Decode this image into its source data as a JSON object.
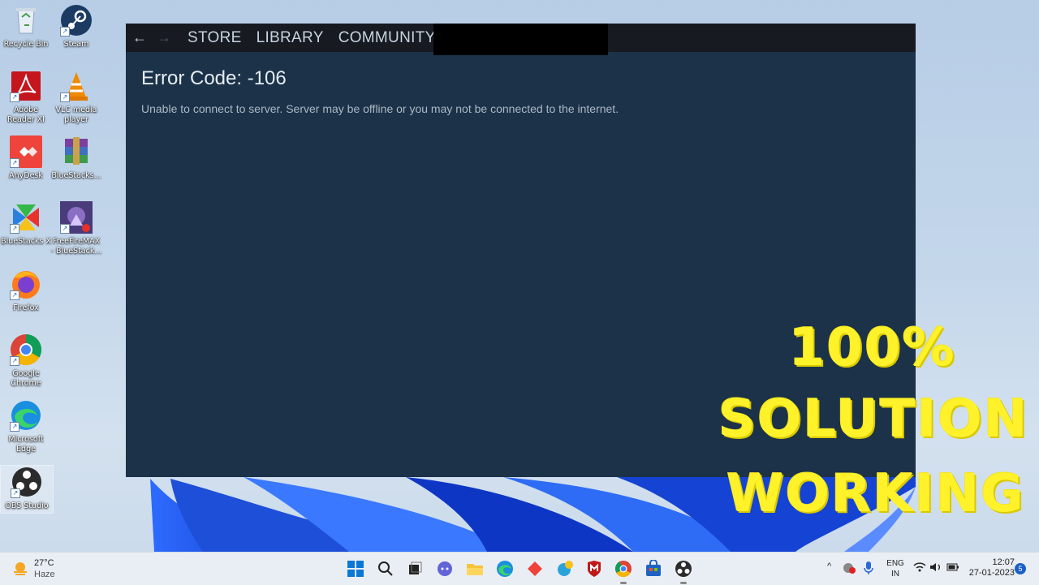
{
  "desktop": {
    "icons": [
      {
        "label": "Recycle Bin",
        "icon": "recycle-bin-icon"
      },
      {
        "label": "Steam",
        "icon": "steam-icon"
      },
      {
        "label": "Adobe Reader XI",
        "icon": "adobe-reader-icon"
      },
      {
        "label": "VLC media player",
        "icon": "vlc-icon"
      },
      {
        "label": "AnyDesk",
        "icon": "anydesk-icon"
      },
      {
        "label": "BlueStacks...",
        "icon": "winrar-icon"
      },
      {
        "label": "BlueStacks X",
        "icon": "bluestacks-x-icon"
      },
      {
        "label": "FreeFireMAX - BlueStack...",
        "icon": "freefire-icon"
      },
      {
        "label": "Firefox",
        "icon": "firefox-icon"
      },
      {
        "label": "Google Chrome",
        "icon": "chrome-icon"
      },
      {
        "label": "Microsoft Edge",
        "icon": "edge-icon"
      },
      {
        "label": "OBS Studio",
        "icon": "obs-icon"
      }
    ]
  },
  "steam": {
    "nav": {
      "back": "←",
      "forward": "→",
      "tabs": [
        "STORE",
        "LIBRARY",
        "COMMUNITY"
      ]
    },
    "error_title": "Error Code: -106",
    "error_message": "Unable to connect to server. Server may be offline or you may not be connected to the internet."
  },
  "promo": {
    "line1": "100%",
    "line2": "SOLUTION",
    "line3": "WORKING",
    "color": "#fff22a"
  },
  "taskbar": {
    "weather": {
      "temp": "27°C",
      "condition": "Haze"
    },
    "language": {
      "lang": "ENG",
      "region": "IN"
    },
    "clock": {
      "time": "12:07",
      "date": "27-01-2023"
    },
    "notification_count": "5"
  }
}
